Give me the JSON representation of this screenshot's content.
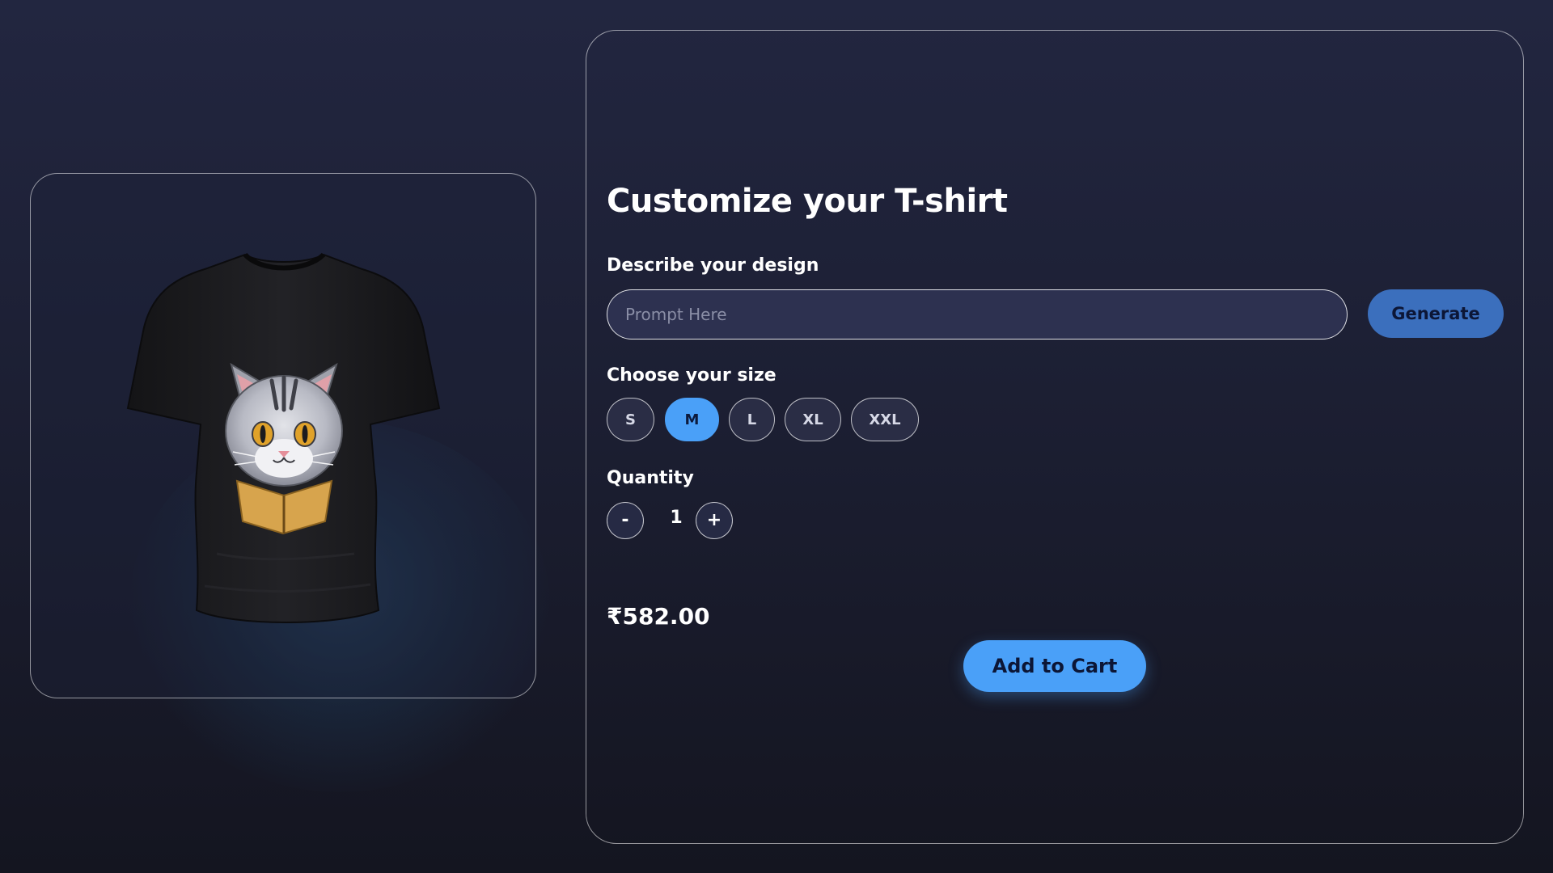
{
  "customizer": {
    "title": "Customize your T-shirt",
    "design_label": "Describe your design",
    "prompt_placeholder": "Prompt Here",
    "prompt_value": "",
    "generate_label": "Generate",
    "size_label": "Choose your size",
    "sizes": [
      "S",
      "M",
      "L",
      "XL",
      "XXL"
    ],
    "selected_size": "M",
    "quantity_label": "Quantity",
    "quantity_decrement": "-",
    "quantity_value": "1",
    "quantity_increment": "+",
    "price": "₹582.00",
    "add_to_cart_label": "Add to Cart"
  },
  "preview": {
    "product": "t-shirt-with-cat-design",
    "shirt_color": "#1b1b1e"
  },
  "colors": {
    "accent": "#4aa0f8",
    "generate_button": "#3b6fbd",
    "background": "#1f2238"
  }
}
